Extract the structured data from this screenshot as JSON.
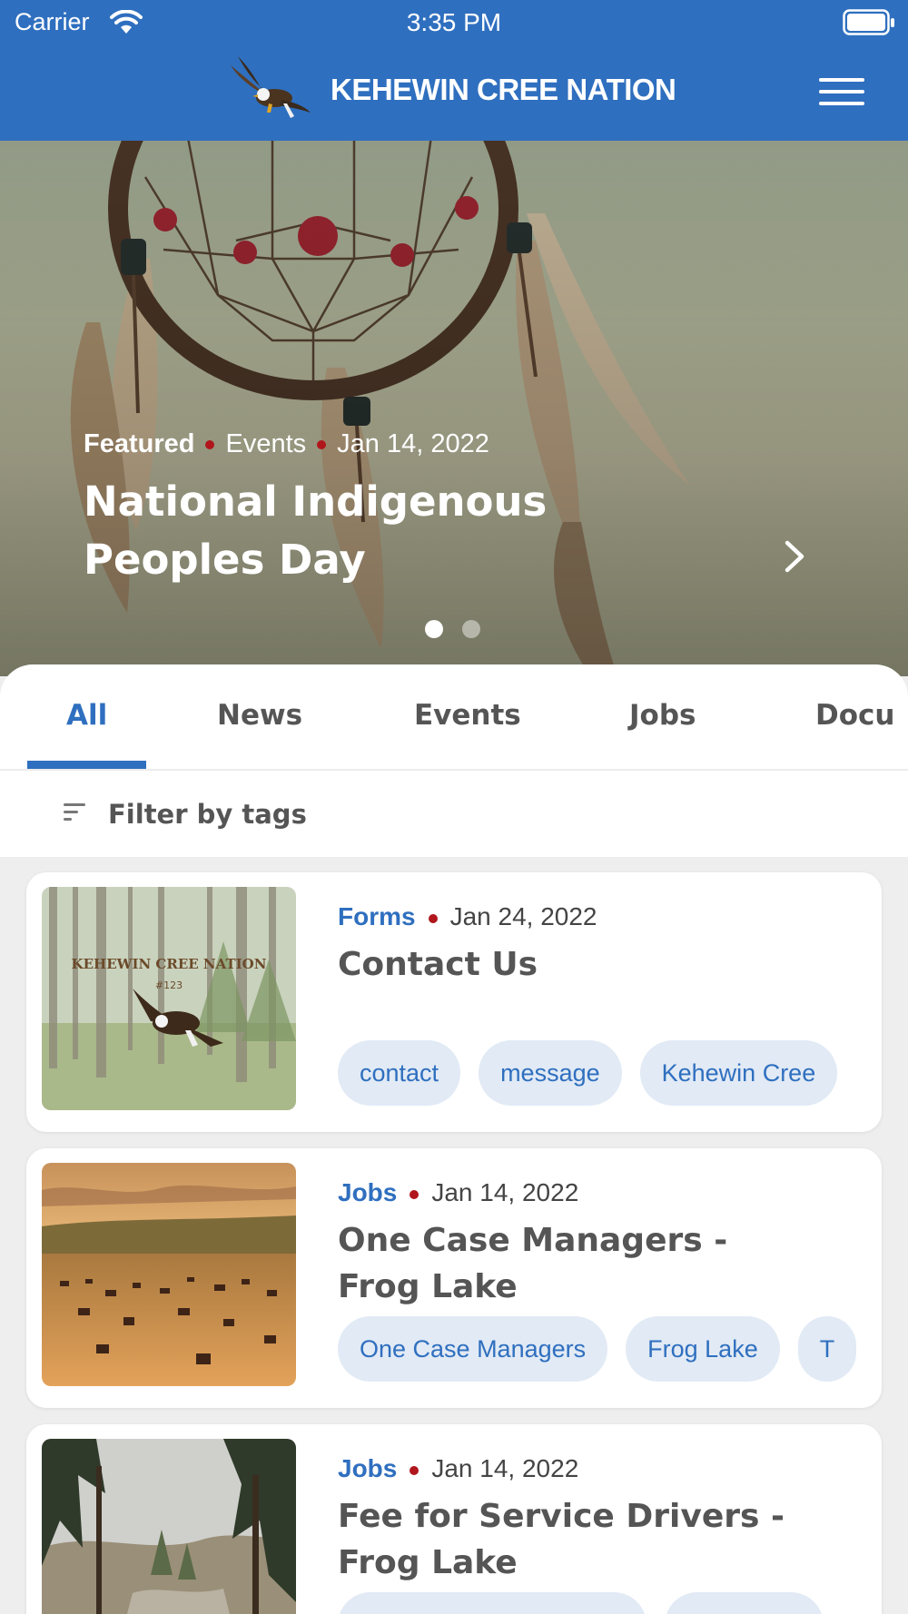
{
  "status_bar": {
    "carrier": "Carrier",
    "time": "3:35 PM"
  },
  "header": {
    "title": "KEHEWIN CREE NATION",
    "logo_icon": "eagle-logo-icon",
    "menu_icon": "hamburger-menu-icon"
  },
  "hero": {
    "featured_label": "Featured",
    "category": "Events",
    "date": "Jan 14, 2022",
    "title": "National Indigenous Peoples Day",
    "pages": 2,
    "active_page": 1
  },
  "tabs": [
    {
      "label": "All",
      "active": true
    },
    {
      "label": "News",
      "active": false
    },
    {
      "label": "Events",
      "active": false
    },
    {
      "label": "Jobs",
      "active": false
    },
    {
      "label": "Docu",
      "active": false
    }
  ],
  "filter": {
    "label": "Filter by tags"
  },
  "cards": [
    {
      "category": "Forms",
      "date": "Jan 24, 2022",
      "title": "Contact Us",
      "tags": [
        "contact",
        "message",
        "Kehewin Cree"
      ]
    },
    {
      "category": "Jobs",
      "date": "Jan 14, 2022",
      "title": "One Case Managers - Frog Lake",
      "tags": [
        "One Case Managers",
        "Frog Lake",
        "T"
      ]
    },
    {
      "category": "Jobs",
      "date": "Jan 14, 2022",
      "title": "Fee for Service Drivers - Frog Lake",
      "tags": []
    }
  ],
  "colors": {
    "brand_blue": "#2f6fbf",
    "accent_red": "#b0161c",
    "tag_bg": "#e1eaf5"
  }
}
